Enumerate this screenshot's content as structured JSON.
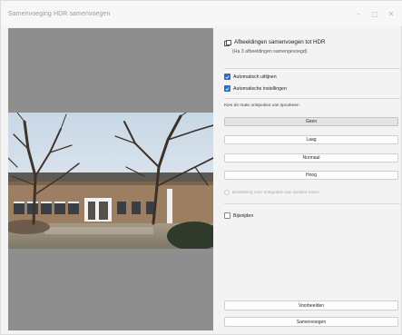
{
  "window": {
    "title": "Samenvoeging HDR samenvoegen",
    "controls": {
      "minimize": "–",
      "maximize": "□",
      "close": "✕"
    }
  },
  "preview": {
    "background": "#8e8e8e",
    "image_subject": "school-building-photo"
  },
  "header": {
    "icon": "hdr-merge-icon",
    "title": "Afbeeldingen samenvoegen tot HDR",
    "subtitle": "(Ha 3 afbeeldingen samengevoegd)"
  },
  "options": {
    "auto_align": {
      "label": "Automatisch uitlijnen",
      "checked": true
    },
    "auto_settings": {
      "label": "Automatische instellingen",
      "checked": true
    }
  },
  "deghost": {
    "label": "Kies de mate ontspoken van spookeen",
    "buttons": [
      {
        "label": "Geen",
        "selected": true
      },
      {
        "label": "Laag",
        "selected": false
      },
      {
        "label": "Normaal",
        "selected": false
      },
      {
        "label": "Hoog",
        "selected": false
      }
    ],
    "overlay_option": {
      "label": "Bedekking voor ontspoken van spoken tonen",
      "enabled": false
    }
  },
  "auto_crop": {
    "label": "Bijsnijden",
    "checked": false
  },
  "footer": {
    "preview_button": "Voorbeelden",
    "merge_button": "Samenvoegen"
  },
  "colors": {
    "accent": "#2f6fc1",
    "panel_background": "#f3f3f3"
  }
}
